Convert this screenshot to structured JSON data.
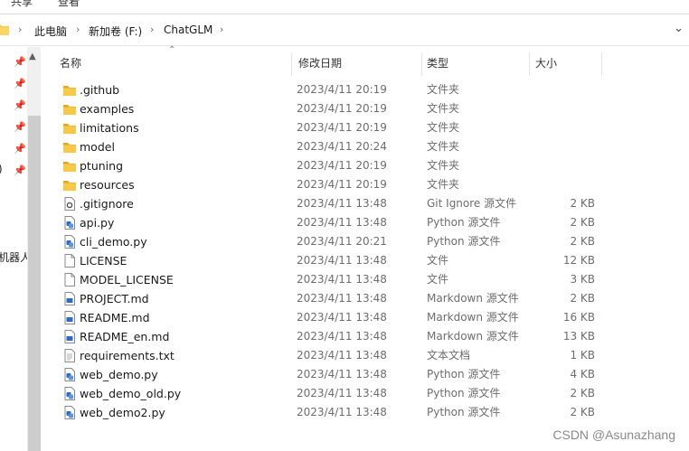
{
  "menu": {
    "items": [
      "共享",
      "查看"
    ]
  },
  "address": {
    "crumbs": [
      "此电脑",
      "新加卷 (F:)",
      "ChatGLM"
    ]
  },
  "nav": {
    "partial_label": "机器人"
  },
  "columns": {
    "name": "名称",
    "modified": "修改日期",
    "type": "类型",
    "size": "大小"
  },
  "files": [
    {
      "name": ".github",
      "modified": "2023/4/11 20:19",
      "type": "文件夹",
      "size": "",
      "icon": "folder-icon"
    },
    {
      "name": "examples",
      "modified": "2023/4/11 20:19",
      "type": "文件夹",
      "size": "",
      "icon": "folder-icon"
    },
    {
      "name": "limitations",
      "modified": "2023/4/11 20:19",
      "type": "文件夹",
      "size": "",
      "icon": "folder-icon"
    },
    {
      "name": "model",
      "modified": "2023/4/11 20:24",
      "type": "文件夹",
      "size": "",
      "icon": "folder-icon"
    },
    {
      "name": "ptuning",
      "modified": "2023/4/11 20:19",
      "type": "文件夹",
      "size": "",
      "icon": "folder-icon"
    },
    {
      "name": "resources",
      "modified": "2023/4/11 20:19",
      "type": "文件夹",
      "size": "",
      "icon": "folder-icon"
    },
    {
      "name": ".gitignore",
      "modified": "2023/4/11 13:48",
      "type": "Git Ignore 源文件",
      "size": "2 KB",
      "icon": "gear-file-icon"
    },
    {
      "name": "api.py",
      "modified": "2023/4/11 13:48",
      "type": "Python 源文件",
      "size": "2 KB",
      "icon": "python-file-icon"
    },
    {
      "name": "cli_demo.py",
      "modified": "2023/4/11 20:21",
      "type": "Python 源文件",
      "size": "2 KB",
      "icon": "python-file-icon"
    },
    {
      "name": "LICENSE",
      "modified": "2023/4/11 13:48",
      "type": "文件",
      "size": "12 KB",
      "icon": "blank-file-icon"
    },
    {
      "name": "MODEL_LICENSE",
      "modified": "2023/4/11 13:48",
      "type": "文件",
      "size": "3 KB",
      "icon": "blank-file-icon"
    },
    {
      "name": "PROJECT.md",
      "modified": "2023/4/11 13:48",
      "type": "Markdown 源文件",
      "size": "2 KB",
      "icon": "markdown-file-icon"
    },
    {
      "name": "README.md",
      "modified": "2023/4/11 13:48",
      "type": "Markdown 源文件",
      "size": "16 KB",
      "icon": "markdown-file-icon"
    },
    {
      "name": "README_en.md",
      "modified": "2023/4/11 13:48",
      "type": "Markdown 源文件",
      "size": "13 KB",
      "icon": "markdown-file-icon"
    },
    {
      "name": "requirements.txt",
      "modified": "2023/4/11 13:48",
      "type": "文本文档",
      "size": "1 KB",
      "icon": "text-file-icon"
    },
    {
      "name": "web_demo.py",
      "modified": "2023/4/11 13:48",
      "type": "Python 源文件",
      "size": "4 KB",
      "icon": "python-file-icon"
    },
    {
      "name": "web_demo_old.py",
      "modified": "2023/4/11 13:48",
      "type": "Python 源文件",
      "size": "2 KB",
      "icon": "python-file-icon"
    },
    {
      "name": "web_demo2.py",
      "modified": "2023/4/11 13:48",
      "type": "Python 源文件",
      "size": "2 KB",
      "icon": "python-file-icon"
    }
  ],
  "watermark": "CSDN @Asunazhang",
  "colors": {
    "folder": "#f7c948",
    "folder_dark": "#e3a81f",
    "accent": "#2b6cc4"
  }
}
